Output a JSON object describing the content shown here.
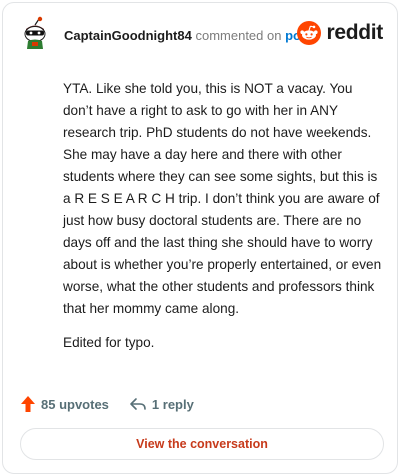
{
  "header": {
    "username": "CaptainGoodnight84",
    "action_text": "commented on",
    "post_link": "post",
    "brand": "reddit"
  },
  "comment": {
    "paragraphs": [
      "YTA. Like she told you, this is NOT a vacay. You don’t have a right to ask to go with her in ANY research trip. PhD students do not have weekends. She may have a day here and there with other students where they can see some sights, but this is a R E S E A R C H trip. I don’t think you are aware of just how busy doctoral students are. There are no days off and the last thing she should have to worry about is whether you’re properly entertained, or even worse, what the other students and professors think that her mommy came along.",
      "Edited for typo."
    ]
  },
  "footer": {
    "upvotes_label": "85 upvotes",
    "replies_label": "1 reply",
    "cta_label": "View the conversation"
  },
  "colors": {
    "upvote": "#ff4500",
    "link": "#0079d3",
    "cta_text": "#c73a1b",
    "muted": "#576f76"
  },
  "icons": {
    "avatar": "snoo-avatar",
    "brand": "reddit-icon",
    "upvote": "upvote-arrow-icon",
    "reply": "reply-arrow-icon"
  }
}
